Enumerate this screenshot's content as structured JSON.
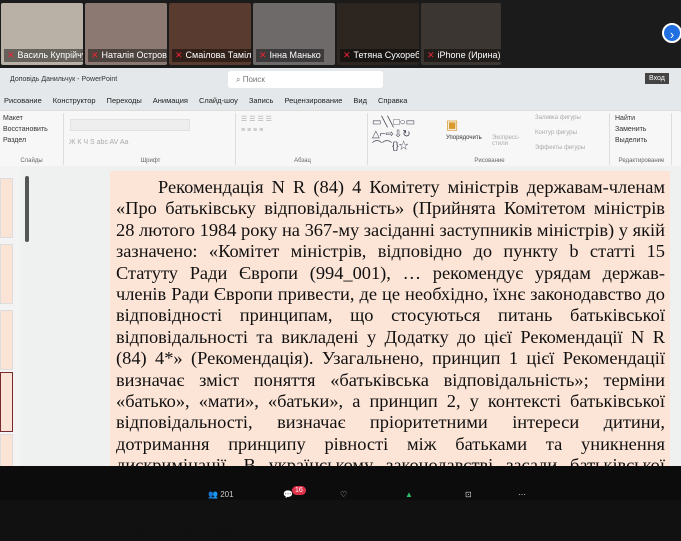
{
  "participants": [
    {
      "name": "Василь Купрійчук",
      "color": "#b9b1a6"
    },
    {
      "name": "Наталія Островська",
      "color": "#8c7a72"
    },
    {
      "name": "Смаілова Таміла",
      "color": "#5a3b2f"
    },
    {
      "name": "Інна Манько",
      "color": "#6e6a6a"
    },
    {
      "name": "Тетяна Сухоребра",
      "color": "#2c2520"
    },
    {
      "name": "iPhone (Ирина)",
      "color": "#3b3632"
    }
  ],
  "app": {
    "title": "Доповідь Данильчук  -  PowerPoint",
    "search_placeholder": "Поиск",
    "login": "Вход"
  },
  "menu": [
    "Рисование",
    "Конструктор",
    "Переходы",
    "Анимация",
    "Слайд-шоу",
    "Запись",
    "Рецензирование",
    "Вид",
    "Справка"
  ],
  "ribbon": {
    "slides": {
      "items": [
        "Макет",
        "Восстановить",
        "Раздел"
      ],
      "label": "Слайды"
    },
    "font": {
      "label": "Шрифт",
      "format": "Ж  К  Ч  S  abc  AV  Aa"
    },
    "paragraph": {
      "label": "Абзац"
    },
    "drawing": {
      "label": "Рисование",
      "arrange": "Упорядочить",
      "styles": "Экспресс-стили",
      "fill": "Заливка фигуры",
      "outline": "Контур фигуры",
      "effects": "Эффекты фигуры"
    },
    "editing": {
      "label": "Редактирование",
      "items": [
        "Найти",
        "Заменить",
        "Выделить"
      ]
    }
  },
  "slide": {
    "text": "Рекомендація N R (84) 4 Комітету міністрів державам-членам «Про батьківську відповідальність» (Прийнята Комітетом міністрів 28 лютого 1984 року на 367-му засіданні заступників міністрів) у якій зазначено: «Комітет міністрів, відповідно до пункту b статті 15 Статуту Ради Європи (994_001), … рекомендує урядам держав-членів Ради Європи привести, де це необхідно, їхнє законодавство до відповідності принципам, що стосуються питань батьківської відповідальності та викладені у Додатку до цієї Рекомендації N R (84) 4*» (Рекомендація). Узагальнено, принцип 1 цієї Рекомендації визначає зміст поняття «батьківська відповідальність»; терміни «батько», «мати», «батьки», а принцип 2, у контексті батьківської відповідальності, визначає пріоритетними інтереси дитини, дотримання принципу рівності між батьками та уникнення дискримінації. В українському законодавстві засади батьківської відповідальності/відповідального батьківства закладено в: Конституції України, Законі України «Про охорону дитинства», Сімейному кодексі України та ін."
  },
  "toolbar": {
    "participants_count": "201",
    "chat_badge": "16"
  }
}
